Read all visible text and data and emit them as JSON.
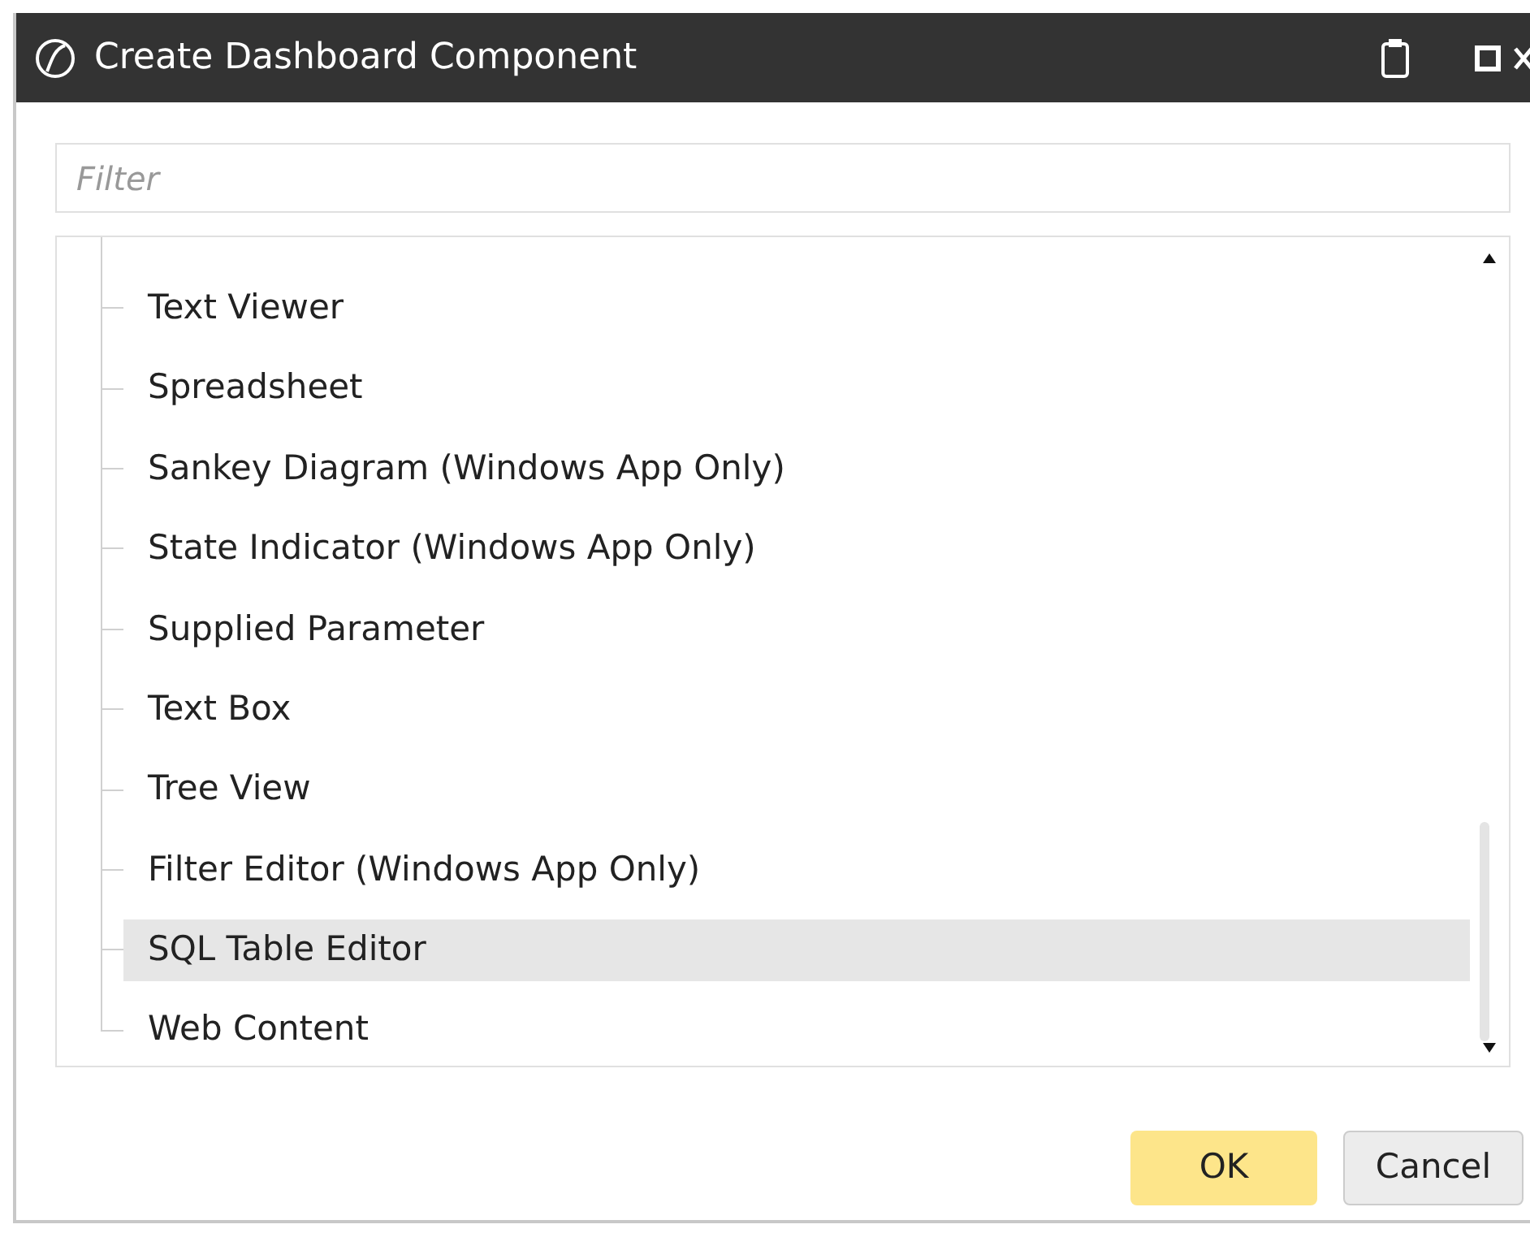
{
  "window": {
    "title": "Create Dashboard Component"
  },
  "filter": {
    "placeholder": "Filter"
  },
  "items": [
    {
      "label": "Text Viewer",
      "selected": false
    },
    {
      "label": "Spreadsheet",
      "selected": false
    },
    {
      "label": "Sankey Diagram (Windows App Only)",
      "selected": false
    },
    {
      "label": "State Indicator (Windows App Only)",
      "selected": false
    },
    {
      "label": "Supplied Parameter",
      "selected": false
    },
    {
      "label": "Text Box",
      "selected": false
    },
    {
      "label": "Tree View",
      "selected": false
    },
    {
      "label": "Filter Editor (Windows App Only)",
      "selected": false
    },
    {
      "label": "SQL Table Editor",
      "selected": true
    },
    {
      "label": "Web Content",
      "selected": false
    }
  ],
  "buttons": [
    {
      "label": "OK",
      "kind": "primary"
    },
    {
      "label": "Cancel",
      "kind": "secondary"
    }
  ]
}
